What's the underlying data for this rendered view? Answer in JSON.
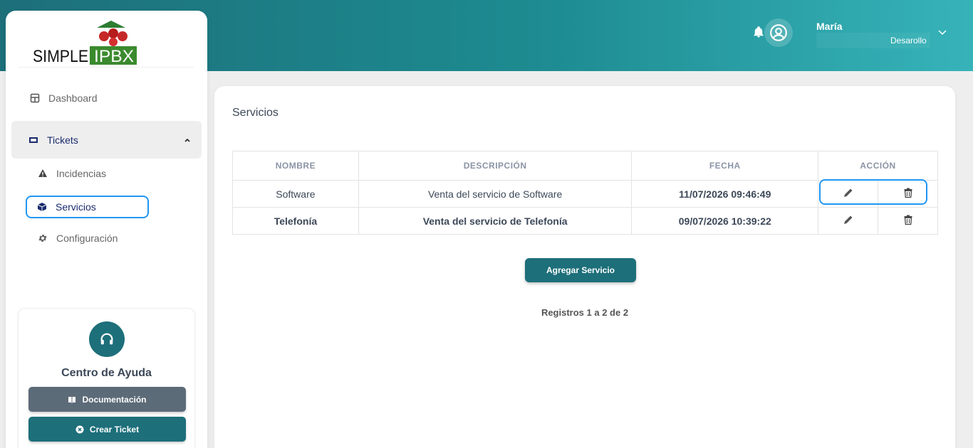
{
  "header": {
    "user_name": "María",
    "user_role": "Desarollo",
    "icons": [
      "bell-icon",
      "user-circle-icon",
      "chevron-down-icon"
    ]
  },
  "logo": {
    "text_left": "SIMPLE",
    "text_right": "IPBX"
  },
  "sidebar": {
    "items": [
      {
        "label": "Dashboard",
        "icon": "dashboard-icon"
      },
      {
        "label": "Tickets",
        "icon": "ticket-icon"
      },
      {
        "label": "Incidencias",
        "icon": "warning-icon"
      },
      {
        "label": "Servicios",
        "icon": "box-icon"
      },
      {
        "label": "Configuración",
        "icon": "gear-icon"
      }
    ]
  },
  "help": {
    "title": "Centro de Ayuda",
    "doc_label": "Documentación",
    "ticket_label": "Crear Ticket"
  },
  "main": {
    "title": "Servicios",
    "columns": [
      "NOMBRE",
      "DESCRIPCIÓN",
      "FECHA",
      "ACCIÓN"
    ],
    "rows": [
      {
        "nombre": "Software",
        "descripcion": "Venta del servicio de Software",
        "fecha": "11/07/2026 09:46:49"
      },
      {
        "nombre": "Telefonía",
        "descripcion": "Venta del servicio de Telefonía",
        "fecha": "09/07/2026 10:39:22"
      }
    ],
    "add_button": "Agregar Servicio",
    "records": "Registros 1 a 2 de 2"
  },
  "colors": {
    "accent": "#1d6f7a",
    "highlight": "#2196f3",
    "doc_button": "#5c6b78"
  }
}
